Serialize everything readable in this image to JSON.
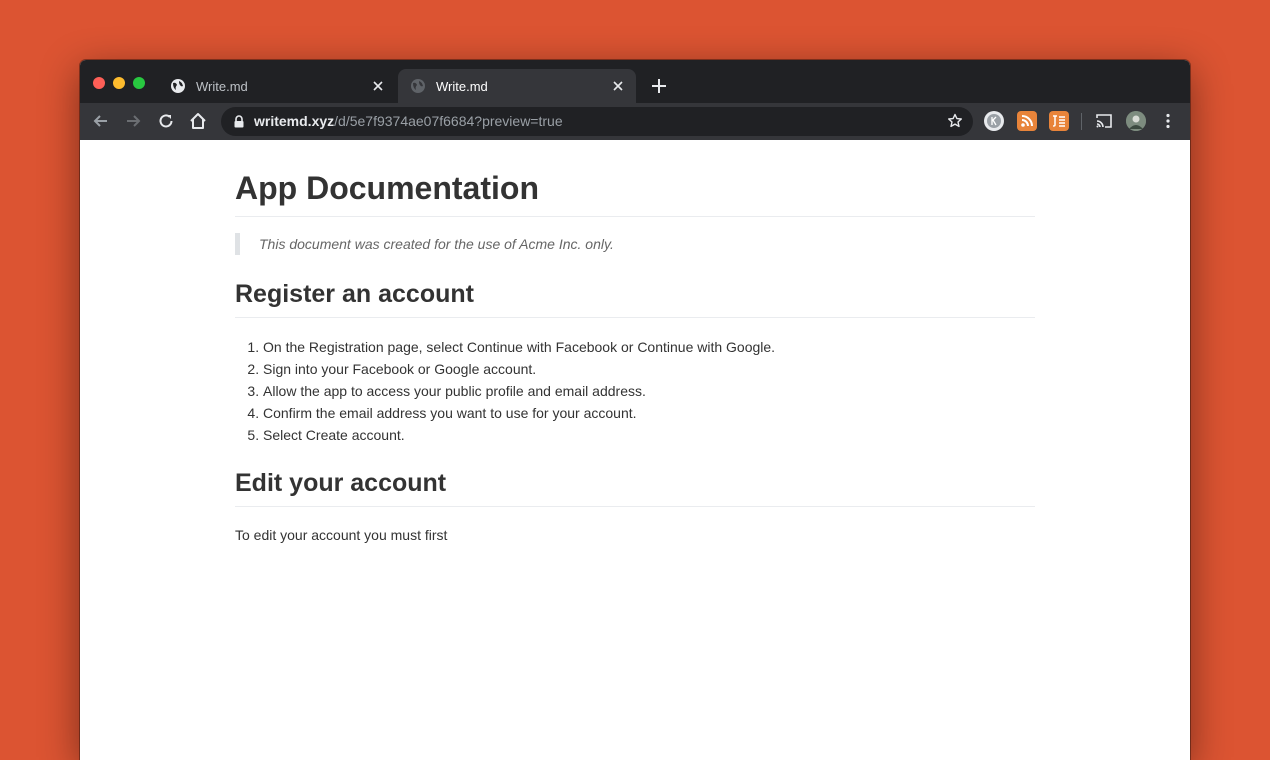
{
  "browser": {
    "tabs": [
      {
        "title": "Write.md",
        "active": false
      },
      {
        "title": "Write.md",
        "active": true
      }
    ],
    "url_host": "writemd.xyz",
    "url_path": "/d/5e7f9374ae07f6684?preview=true"
  },
  "document": {
    "title": "App Documentation",
    "note": "This document was created for the use of Acme Inc. only.",
    "sections": [
      {
        "heading": "Register an account",
        "steps": [
          "On the Registration page, select Continue with Facebook or Continue with Google.",
          "Sign into your Facebook or Google account.",
          "Allow the app to access your public profile and email address.",
          "Confirm the email address you want to use for your account.",
          "Select Create account."
        ]
      },
      {
        "heading": "Edit your account",
        "body": "To edit your account you must first"
      }
    ]
  },
  "icons": {
    "back": "arrow-left-icon",
    "forward": "arrow-right-icon",
    "reload": "reload-icon",
    "home": "home-icon",
    "bookmark": "star-icon",
    "cast": "cast-icon",
    "menu": "kebab-menu-icon"
  },
  "colors": {
    "background": "#dc5432",
    "titlebar": "#202124",
    "toolbar": "#35363a",
    "rss_extension": "#e8843a"
  }
}
